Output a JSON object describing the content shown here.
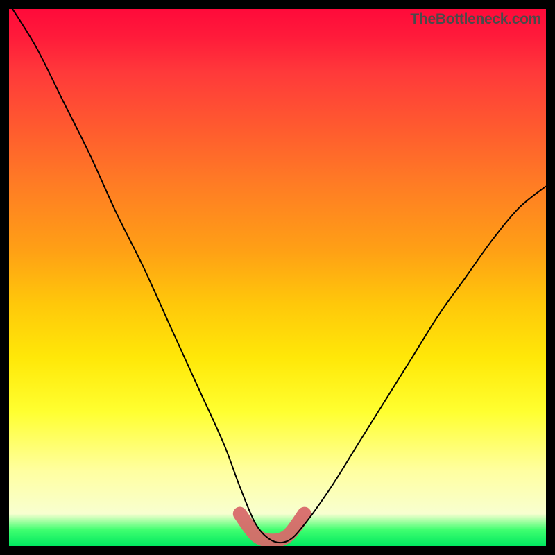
{
  "watermark": "TheBottleneck.com",
  "chart_data": {
    "type": "line",
    "title": "",
    "xlabel": "",
    "ylabel": "",
    "xlim": [
      0,
      100
    ],
    "ylim": [
      0,
      100
    ],
    "grid": false,
    "legend": false,
    "series": [
      {
        "name": "bottleneck-curve",
        "x": [
          0,
          5,
          10,
          15,
          20,
          25,
          30,
          35,
          40,
          43,
          46,
          49,
          52,
          55,
          60,
          65,
          70,
          75,
          80,
          85,
          90,
          95,
          100
        ],
        "y": [
          101,
          93,
          83,
          73,
          62,
          52,
          41,
          30,
          19,
          11,
          4,
          1,
          1,
          4,
          11,
          19,
          27,
          35,
          43,
          50,
          57,
          63,
          67
        ]
      },
      {
        "name": "optimal-zone-highlight",
        "x": [
          43,
          46,
          49,
          52,
          55
        ],
        "y": [
          6,
          2,
          1,
          2,
          6
        ]
      }
    ]
  }
}
